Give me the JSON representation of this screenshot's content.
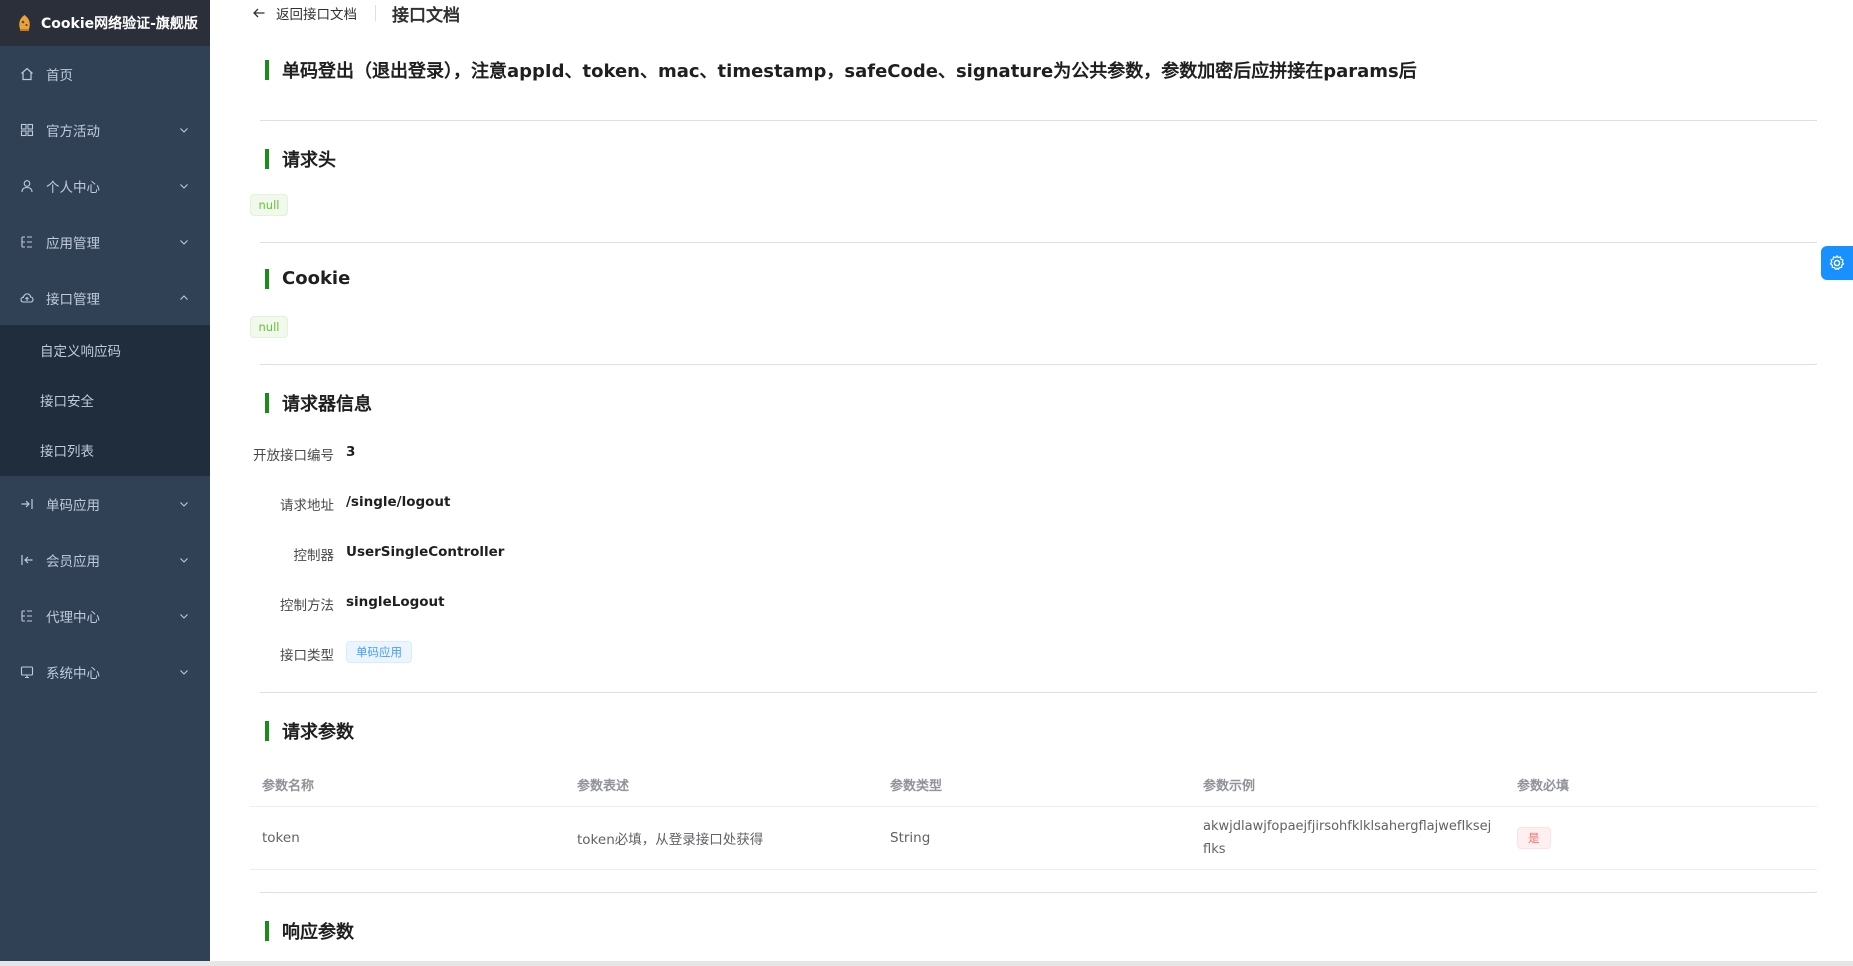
{
  "app": {
    "title": "Cookie网络验证-旗舰版"
  },
  "sidebar": {
    "items": [
      {
        "label": "首页",
        "icon": "home-icon"
      },
      {
        "label": "官方活动",
        "icon": "grid-icon"
      },
      {
        "label": "个人中心",
        "icon": "user-icon"
      },
      {
        "label": "应用管理",
        "icon": "tree-icon"
      },
      {
        "label": "接口管理",
        "icon": "cloud-icon",
        "expanded": true
      },
      {
        "label": "单码应用",
        "icon": "login-icon"
      },
      {
        "label": "会员应用",
        "icon": "logout-icon"
      },
      {
        "label": "代理中心",
        "icon": "tree-icon"
      },
      {
        "label": "系统中心",
        "icon": "monitor-icon"
      }
    ],
    "subitems": [
      {
        "label": "自定义响应码"
      },
      {
        "label": "接口安全"
      },
      {
        "label": "接口列表"
      }
    ]
  },
  "header": {
    "back_label": "返回接口文档",
    "title": "接口文档"
  },
  "doc": {
    "main_title": "单码登出（退出登录），注意appId、token、mac、timestamp，safeCode、signature为公共参数，参数加密后应拼接在params后",
    "headers_title": "请求头",
    "headers_value": "null",
    "cookie_title": "Cookie",
    "cookie_value": "null",
    "info_title": "请求器信息",
    "info": {
      "id_label": "开放接口编号",
      "id_value": "3",
      "url_label": "请求地址",
      "url_value": "/single/logout",
      "controller_label": "控制器",
      "controller_value": "UserSingleController",
      "method_label": "控制方法",
      "method_value": "singleLogout",
      "type_label": "接口类型",
      "type_value": "单码应用"
    },
    "params_title": "请求参数",
    "params_columns": [
      "参数名称",
      "参数表述",
      "参数类型",
      "参数示例",
      "参数必填"
    ],
    "params_rows": [
      {
        "name": "token",
        "desc": "token必填，从登录接口处获得",
        "type": "String",
        "example": "akwjdlawjfopaejfjirsohfklklsahergflajwefIksejflks",
        "required": "是"
      }
    ],
    "response_title": "响应参数"
  },
  "colors": {
    "sidebar_bg": "#304156",
    "sidebar_logo_bg": "#2b2f3a",
    "submenu_bg": "#1f2d3d",
    "accent_green": "#1a8c1a",
    "primary_blue": "#1890ff"
  }
}
